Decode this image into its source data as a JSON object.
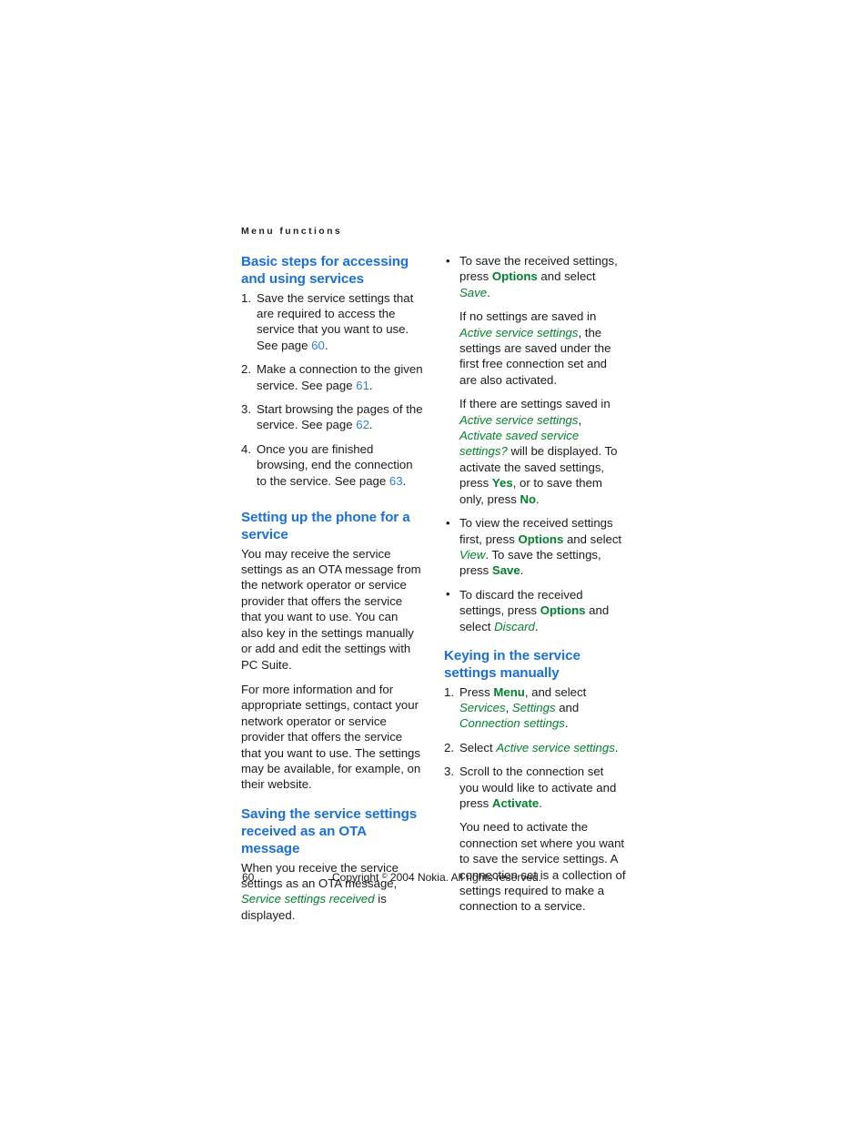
{
  "running_head": "Menu functions",
  "colors": {
    "heading_blue": "#1b6fd8",
    "ui_green": "#00802b",
    "pageref_blue": "#2b7fdb",
    "body_text": "#1a1a1a"
  },
  "left_column": {
    "section1": {
      "title": "Basic steps for accessing and using services",
      "steps": [
        {
          "marker": "1.",
          "text_before": "Save the service settings that are required to access the service that you want to use. See page ",
          "pageref": "60",
          "text_after": "."
        },
        {
          "marker": "2.",
          "text_before": "Make a connection to the given service. See page ",
          "pageref": "61",
          "text_after": "."
        },
        {
          "marker": "3.",
          "text_before": "Start browsing the pages of the service. See page ",
          "pageref": "62",
          "text_after": "."
        },
        {
          "marker": "4.",
          "text_before": "Once you are finished browsing, end the connection to the service. See page ",
          "pageref": "63",
          "text_after": "."
        }
      ]
    },
    "section2": {
      "title": "Setting up the phone for a service",
      "paragraph1": "You may receive the service settings as an OTA message from the network operator or service provider that offers the service that you want to use. You can also key in the settings manually or add and edit the settings with PC Suite.",
      "paragraph2": "For more information and for appropriate settings, contact your network operator or service provider that offers the service that you want to use. The settings may be available, for example, on their website."
    },
    "section3": {
      "title": "Saving the service settings received as an OTA message",
      "para_part1": "When you receive the service settings as an OTA message, ",
      "para_menu": "Service settings received",
      "para_part2": " is displayed."
    }
  },
  "right_column": {
    "bullets_top": [
      {
        "bullet": "•",
        "p1_a": "To save the received settings, press ",
        "p1_key": "Options",
        "p1_b": " and select ",
        "p1_menu": "Save",
        "p1_c": ".",
        "p2_a": "If no settings are saved in ",
        "p2_menu": "Active service settings",
        "p2_b": ", the settings are saved under the first free connection set and are also activated.",
        "p3_a": "If there are settings saved in ",
        "p3_menu1": "Active service settings",
        "p3_b": ", ",
        "p3_menu2": "Activate saved service settings?",
        "p3_c": " will be displayed. To activate the saved settings, press ",
        "p3_key1": "Yes",
        "p3_d": ", or to save them only, press ",
        "p3_key2": "No",
        "p3_e": "."
      },
      {
        "bullet": "•",
        "a": "To view the received settings first, press ",
        "key1": "Options",
        "b": " and select ",
        "menu1": "View",
        "c": ". To save the settings, press ",
        "key2": "Save",
        "d": "."
      },
      {
        "bullet": "•",
        "a": "To discard the received settings, press ",
        "key1": "Options",
        "b": " and select ",
        "menu1": "Discard",
        "c": "."
      }
    ],
    "section_manual": {
      "title": "Keying in the service settings manually",
      "steps": [
        {
          "marker": "1.",
          "a": "Press ",
          "key1": "Menu",
          "b": ", and select ",
          "menu1": "Services",
          "c": ", ",
          "menu2": "Settings",
          "d": " and ",
          "menu3": "Connection settings",
          "e": "."
        },
        {
          "marker": "2.",
          "a": "Select ",
          "menu1": "Active service settings",
          "b": "."
        },
        {
          "marker": "3.",
          "a": "Scroll to the connection set you would like to activate and press ",
          "key1": "Activate",
          "b": ".",
          "sub": "You need to activate the connection set where you want to save the service settings. A connection set is a collection of settings required to make a connection to a service."
        }
      ]
    }
  },
  "footer": {
    "page_number": "60",
    "copyright_before": "Copyright ",
    "copyright_symbol": "©",
    "copyright_after": " 2004 Nokia. All rights reserved."
  }
}
